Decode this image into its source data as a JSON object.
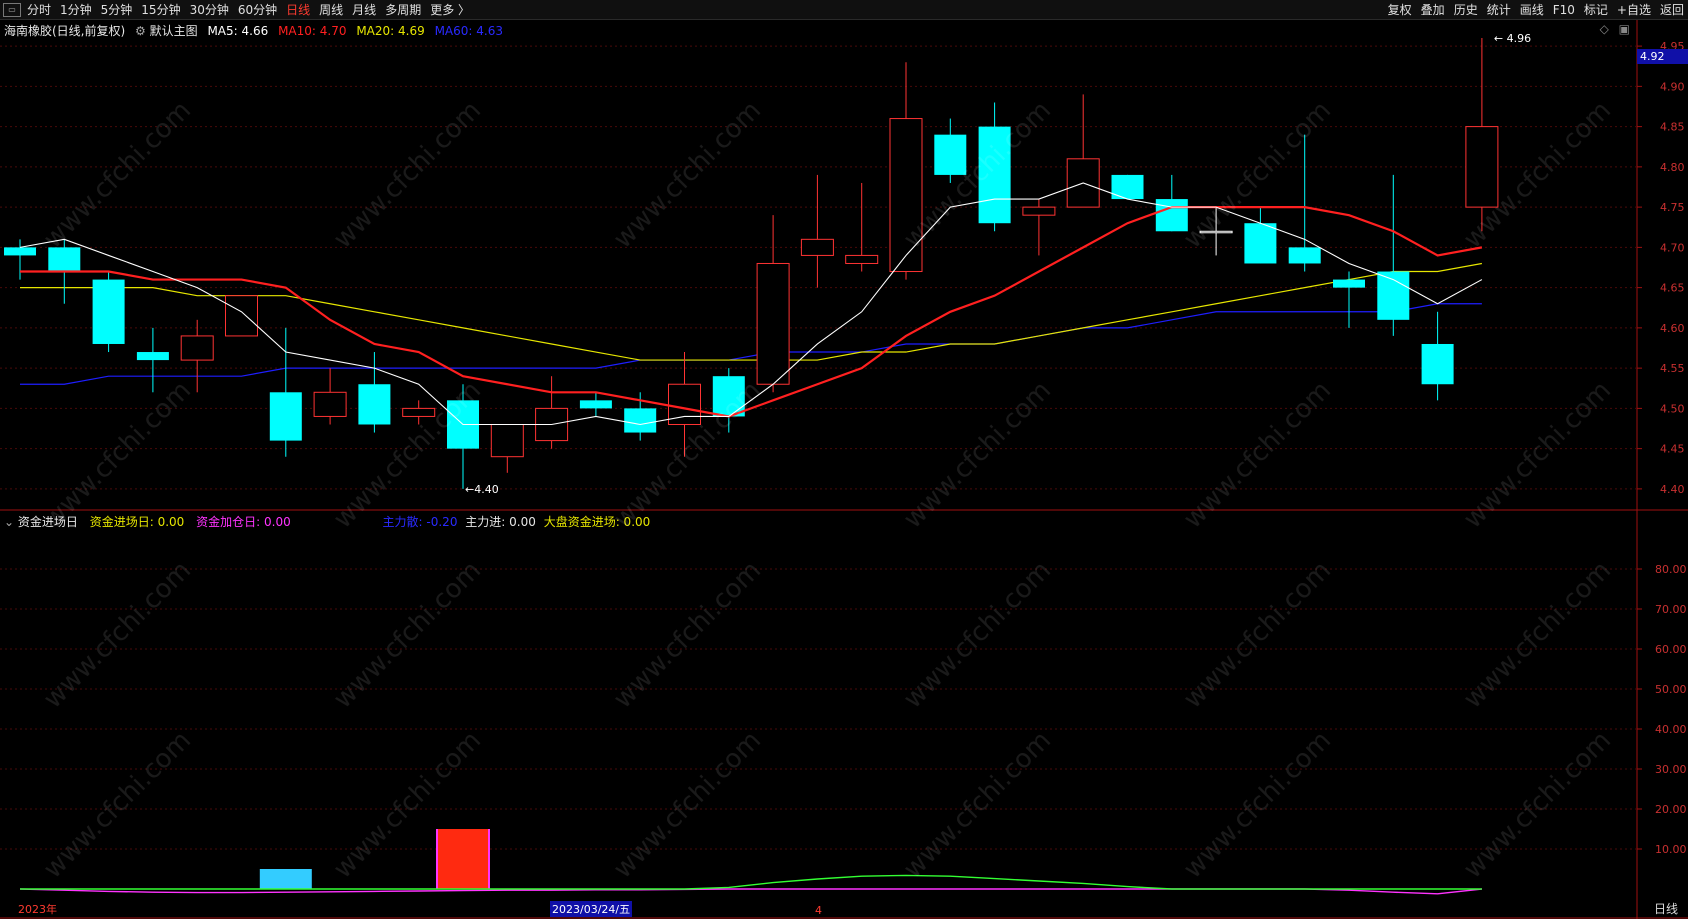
{
  "topbar": {
    "menu_icon": "window-icon",
    "periods": [
      "分时",
      "1分钟",
      "5分钟",
      "15分钟",
      "30分钟",
      "60分钟",
      "日线",
      "周线",
      "月线",
      "多周期",
      "更多 〉"
    ],
    "active_period": "日线",
    "right_menu": [
      "复权",
      "叠加",
      "历史",
      "统计",
      "画线",
      "F10",
      "标记",
      "+自选",
      "返回"
    ]
  },
  "main_title": {
    "stock": "海南橡胶(日线,前复权)",
    "template": "默认主图",
    "ma5": "MA5: 4.66",
    "ma10": "MA10: 4.70",
    "ma20": "MA20: 4.69",
    "ma60": "MA60: 4.63"
  },
  "sub_title": {
    "name": "资金进场日",
    "l1": "资金进场日: 0.00",
    "l2": "资金加仓日: 0.00",
    "l3": "主力散: -0.20",
    "l4": "主力进: 0.00",
    "l5": "大盘资金进场: 0.00"
  },
  "annotations": {
    "high": "4.96",
    "low": "4.40",
    "last_price": "4.92"
  },
  "axis": {
    "price_ticks": [
      "4.95",
      "4.90",
      "4.85",
      "4.80",
      "4.75",
      "4.70",
      "4.65",
      "4.60",
      "4.55",
      "4.50",
      "4.45",
      "4.40"
    ],
    "sub_ticks": [
      "80.00",
      "70.00",
      "60.00",
      "50.00",
      "40.00",
      "30.00",
      "20.00",
      "10.00"
    ]
  },
  "bottom": {
    "year": "2023年",
    "date": "2023/03/24/五",
    "month": "4",
    "period": "日线"
  },
  "watermark": "www.cfchi.com",
  "colors": {
    "up": "#ff3333",
    "down": "#00ffff",
    "ma5": "#ffffff",
    "ma10": "#ff2020",
    "ma20": "#e6e600",
    "ma60": "#1e1eff"
  },
  "chart_data": {
    "type": "candlestick",
    "price_range": [
      4.38,
      4.97
    ],
    "candles": [
      {
        "o": 4.7,
        "h": 4.71,
        "l": 4.66,
        "c": 4.69
      },
      {
        "o": 4.7,
        "h": 4.71,
        "l": 4.63,
        "c": 4.67
      },
      {
        "o": 4.66,
        "h": 4.67,
        "l": 4.57,
        "c": 4.58
      },
      {
        "o": 4.57,
        "h": 4.6,
        "l": 4.52,
        "c": 4.56
      },
      {
        "o": 4.56,
        "h": 4.61,
        "l": 4.52,
        "c": 4.59
      },
      {
        "o": 4.59,
        "h": 4.64,
        "l": 4.59,
        "c": 4.64
      },
      {
        "o": 4.52,
        "h": 4.6,
        "l": 4.44,
        "c": 4.46
      },
      {
        "o": 4.49,
        "h": 4.55,
        "l": 4.48,
        "c": 4.52
      },
      {
        "o": 4.53,
        "h": 4.57,
        "l": 4.47,
        "c": 4.48
      },
      {
        "o": 4.49,
        "h": 4.51,
        "l": 4.48,
        "c": 4.5
      },
      {
        "o": 4.51,
        "h": 4.53,
        "l": 4.4,
        "c": 4.45
      },
      {
        "o": 4.44,
        "h": 4.48,
        "l": 4.42,
        "c": 4.48
      },
      {
        "o": 4.46,
        "h": 4.54,
        "l": 4.45,
        "c": 4.5
      },
      {
        "o": 4.51,
        "h": 4.52,
        "l": 4.49,
        "c": 4.5
      },
      {
        "o": 4.5,
        "h": 4.52,
        "l": 4.46,
        "c": 4.47
      },
      {
        "o": 4.48,
        "h": 4.57,
        "l": 4.44,
        "c": 4.53
      },
      {
        "o": 4.54,
        "h": 4.55,
        "l": 4.47,
        "c": 4.49
      },
      {
        "o": 4.53,
        "h": 4.74,
        "l": 4.52,
        "c": 4.68
      },
      {
        "o": 4.69,
        "h": 4.79,
        "l": 4.65,
        "c": 4.71
      },
      {
        "o": 4.68,
        "h": 4.78,
        "l": 4.67,
        "c": 4.69
      },
      {
        "o": 4.67,
        "h": 4.93,
        "l": 4.66,
        "c": 4.86
      },
      {
        "o": 4.84,
        "h": 4.86,
        "l": 4.78,
        "c": 4.79
      },
      {
        "o": 4.85,
        "h": 4.88,
        "l": 4.72,
        "c": 4.73
      },
      {
        "o": 4.74,
        "h": 4.76,
        "l": 4.69,
        "c": 4.75
      },
      {
        "o": 4.75,
        "h": 4.89,
        "l": 4.75,
        "c": 4.81
      },
      {
        "o": 4.79,
        "h": 4.79,
        "l": 4.76,
        "c": 4.76
      },
      {
        "o": 4.76,
        "h": 4.79,
        "l": 4.72,
        "c": 4.72
      },
      {
        "o": 4.72,
        "h": 4.75,
        "l": 4.69,
        "c": 4.72
      },
      {
        "o": 4.73,
        "h": 4.75,
        "l": 4.68,
        "c": 4.68
      },
      {
        "o": 4.7,
        "h": 4.84,
        "l": 4.67,
        "c": 4.68
      },
      {
        "o": 4.66,
        "h": 4.67,
        "l": 4.6,
        "c": 4.65
      },
      {
        "o": 4.67,
        "h": 4.79,
        "l": 4.59,
        "c": 4.61
      },
      {
        "o": 4.58,
        "h": 4.62,
        "l": 4.51,
        "c": 4.53
      },
      {
        "o": 4.75,
        "h": 4.96,
        "l": 4.72,
        "c": 4.85
      }
    ],
    "ma5": [
      4.7,
      4.71,
      4.69,
      4.67,
      4.65,
      4.62,
      4.57,
      4.56,
      4.55,
      4.53,
      4.48,
      4.48,
      4.48,
      4.49,
      4.48,
      4.49,
      4.49,
      4.53,
      4.58,
      4.62,
      4.69,
      4.75,
      4.76,
      4.76,
      4.78,
      4.76,
      4.75,
      4.75,
      4.73,
      4.71,
      4.68,
      4.66,
      4.63,
      4.66
    ],
    "ma10": [
      4.67,
      4.67,
      4.67,
      4.66,
      4.66,
      4.66,
      4.65,
      4.61,
      4.58,
      4.57,
      4.54,
      4.53,
      4.52,
      4.52,
      4.51,
      4.5,
      4.49,
      4.51,
      4.53,
      4.55,
      4.59,
      4.62,
      4.64,
      4.67,
      4.7,
      4.73,
      4.75,
      4.75,
      4.75,
      4.75,
      4.74,
      4.72,
      4.69,
      4.7
    ],
    "ma20": [
      4.65,
      4.65,
      4.65,
      4.65,
      4.64,
      4.64,
      4.64,
      4.63,
      4.62,
      4.61,
      4.6,
      4.59,
      4.58,
      4.57,
      4.56,
      4.56,
      4.56,
      4.56,
      4.56,
      4.57,
      4.57,
      4.58,
      4.58,
      4.59,
      4.6,
      4.61,
      4.62,
      4.63,
      4.64,
      4.65,
      4.66,
      4.67,
      4.67,
      4.68
    ],
    "ma60": [
      4.53,
      4.53,
      4.54,
      4.54,
      4.54,
      4.54,
      4.55,
      4.55,
      4.55,
      4.55,
      4.55,
      4.55,
      4.55,
      4.55,
      4.56,
      4.56,
      4.56,
      4.57,
      4.57,
      4.57,
      4.58,
      4.58,
      4.58,
      4.59,
      4.6,
      4.6,
      4.61,
      4.62,
      4.62,
      4.62,
      4.62,
      4.62,
      4.63,
      4.63
    ],
    "sub_range": [
      0,
      90
    ],
    "sub_bars": [
      {
        "index": 6,
        "value": 5,
        "color": "#33ccff"
      },
      {
        "index": 10,
        "value": 15,
        "color": "#ff2a10"
      }
    ],
    "sub_green": [
      0,
      0,
      0,
      0,
      0,
      0,
      0,
      0,
      0,
      0,
      0,
      0,
      0,
      0,
      0,
      0,
      0.4,
      1.6,
      2.5,
      3.2,
      3.4,
      3.2,
      2.6,
      2.0,
      1.4,
      0.6,
      0,
      0,
      0,
      0,
      0,
      0,
      0,
      0
    ],
    "sub_magenta": [
      0,
      -0.3,
      -0.6,
      -0.8,
      -0.9,
      -0.9,
      -0.8,
      -0.7,
      -0.6,
      -0.5,
      -0.4,
      -0.3,
      -0.3,
      -0.2,
      -0.2,
      -0.1,
      0,
      0,
      0,
      0,
      0,
      0,
      0,
      0,
      0,
      0,
      0,
      0,
      0,
      0,
      -0.3,
      -0.8,
      -1.2,
      0
    ]
  }
}
